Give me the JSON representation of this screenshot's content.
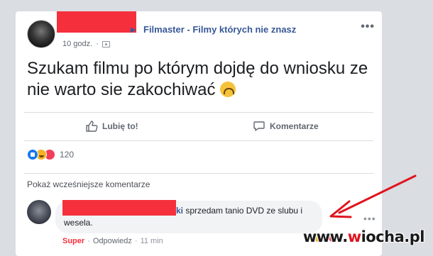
{
  "post": {
    "group_name": "Filmaster - Filmy których nie znasz",
    "timestamp": "10 godz.",
    "text": "Szukam filmu po którym dojdę do wniosku ze nie warto sie zakochiwać",
    "more_label": "•••"
  },
  "actions": {
    "like_label": "Lubię to!",
    "comment_label": "Komentarze"
  },
  "reactions": {
    "count": "120"
  },
  "comments": {
    "previous_label": "Pokaż wcześniejsze komentarze",
    "comment1": {
      "name_suffix": "ki",
      "text_line1": "sprzedam tanio DVD ze slubu i",
      "text_line2": "wesela.",
      "reaction_label": "Super",
      "reply_label": "Odpowiedz",
      "time": "11 min",
      "separator": "·",
      "more_label": "•••"
    }
  },
  "watermark": {
    "prefix": "www.",
    "x": "w",
    "rest": "iocha.pl"
  },
  "colors": {
    "redaction": "#f5303c",
    "link": "#385898",
    "arrow": "#e0141e"
  }
}
